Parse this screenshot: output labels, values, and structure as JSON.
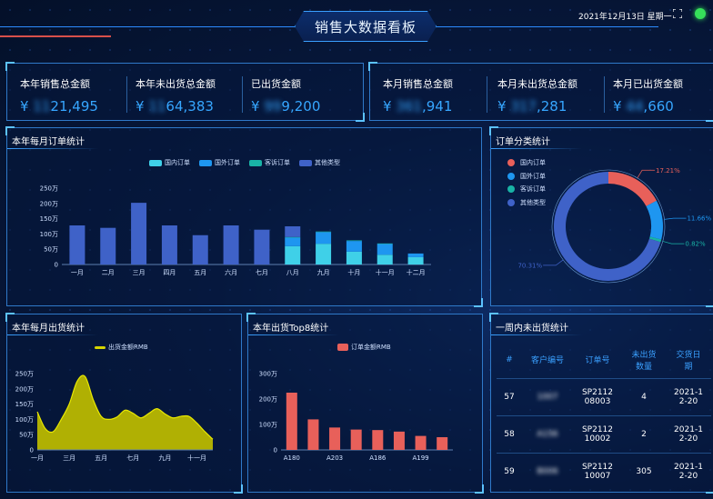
{
  "header": {
    "title": "销售大数据看板",
    "datetime": "2021年12月13日 星期一"
  },
  "stats_left": [
    {
      "label": "本年销售总金额",
      "prefix": "¥",
      "hidden": "11",
      "value": "21,495"
    },
    {
      "label": "本年未出货总金额",
      "prefix": "¥",
      "hidden": "11",
      "value": "64,383"
    },
    {
      "label": "已出货金额",
      "prefix": "¥",
      "hidden": "99",
      "value": "9,200"
    }
  ],
  "stats_right": [
    {
      "label": "本月销售总金额",
      "prefix": "¥",
      "hidden": "361",
      "value": ",941"
    },
    {
      "label": "本月未出货总金额",
      "prefix": "¥",
      "hidden": "317",
      "value": ",281"
    },
    {
      "label": "本月已出货金额",
      "prefix": "¥",
      "hidden": "44",
      "value": ",660"
    }
  ],
  "panels": {
    "monthly_orders": "本年每月订单统计",
    "order_category": "订单分类统计",
    "monthly_shipments": "本年每月出货统计",
    "top8": "本年出货Top8统计",
    "week_unshipped": "一周内未出货统计"
  },
  "chart_data": [
    {
      "type": "bar",
      "title": "本年每月订单统计",
      "categories": [
        "一月",
        "二月",
        "三月",
        "四月",
        "五月",
        "六月",
        "七月",
        "八月",
        "九月",
        "十月",
        "十一月",
        "十二月"
      ],
      "yticks": [
        "0",
        "50万",
        "100万",
        "150万",
        "200万",
        "250万"
      ],
      "ylim": [
        0,
        250
      ],
      "legend": "top",
      "series": [
        {
          "name": "国内订单",
          "color": "#3fd0e8",
          "values": [
            0,
            0,
            0,
            0,
            0,
            0,
            0,
            60,
            68,
            42,
            32,
            24
          ]
        },
        {
          "name": "国外订单",
          "color": "#1e96f0",
          "values": [
            0,
            0,
            0,
            0,
            0,
            0,
            0,
            28,
            38,
            35,
            35,
            12
          ]
        },
        {
          "name": "客诉订单",
          "color": "#19b3a6",
          "values": [
            0,
            0,
            0,
            0,
            0,
            0,
            0,
            2,
            2,
            2,
            2,
            0
          ]
        },
        {
          "name": "其他类型",
          "color": "#3f62c8",
          "values": [
            128,
            120,
            202,
            128,
            96,
            128,
            114,
            35,
            0,
            0,
            0,
            0
          ]
        }
      ]
    },
    {
      "type": "pie",
      "title": "订单分类统计",
      "legend": "top-left",
      "slices": [
        {
          "name": "国内订单",
          "value": 17.21,
          "label": "17.21%",
          "color": "#e8605a"
        },
        {
          "name": "国外订单",
          "value": 11.66,
          "label": "11.66%",
          "color": "#1e96f0"
        },
        {
          "name": "客诉订单",
          "value": 0.82,
          "label": "0.82%",
          "color": "#19b3a6"
        },
        {
          "name": "其他类型",
          "value": 70.31,
          "label": "70.31%",
          "color": "#3f62c8"
        }
      ]
    },
    {
      "type": "area",
      "title": "本年每月出货统计",
      "legend": "top",
      "series": [
        {
          "name": "出货金额RMB",
          "color": "#d6d600"
        }
      ],
      "xticks": [
        "一月",
        "三月",
        "五月",
        "七月",
        "九月",
        "十一月"
      ],
      "yticks": [
        "0",
        "50万",
        "100万",
        "150万",
        "200万",
        "250万"
      ],
      "ylim": [
        0,
        250
      ],
      "x": [
        1,
        1.5,
        2,
        2.5,
        3,
        3.5,
        4,
        4.5,
        5,
        5.5,
        6,
        6.5,
        7,
        7.5,
        8,
        8.5,
        9,
        9.5,
        10,
        10.5,
        11,
        11.5,
        12
      ],
      "values": [
        125,
        70,
        60,
        100,
        150,
        225,
        240,
        165,
        110,
        100,
        108,
        130,
        120,
        105,
        120,
        135,
        118,
        105,
        110,
        110,
        88,
        60,
        35
      ]
    },
    {
      "type": "bar",
      "title": "本年出货Top8统计",
      "legend": "top",
      "series": [
        {
          "name": "订单金额RMB",
          "color": "#e8605a"
        }
      ],
      "categories": [
        "A180",
        "",
        "A203",
        "",
        "A186",
        "",
        "A199",
        ""
      ],
      "xticks": [
        "A180",
        "A203",
        "A186",
        "A199"
      ],
      "yticks": [
        "0",
        "100万",
        "200万",
        "300万"
      ],
      "ylim": [
        0,
        300
      ],
      "values": [
        225,
        120,
        88,
        80,
        78,
        72,
        55,
        50
      ]
    }
  ],
  "week_table": {
    "headers": [
      "#",
      "客户编号",
      "订单号",
      "未出货\n数量",
      "交货日\n期"
    ],
    "rows": [
      {
        "idx": "57",
        "customer": "1007",
        "order": "SP2112\n08003",
        "qty": "4",
        "date": "2021-1\n2-20"
      },
      {
        "idx": "58",
        "customer": "A156",
        "order": "SP2112\n10002",
        "qty": "2",
        "date": "2021-1\n2-20"
      },
      {
        "idx": "59",
        "customer": "B006",
        "order": "SP2112\n10007",
        "qty": "305",
        "date": "2021-1\n2-20"
      }
    ]
  },
  "colors": {
    "accent": "#3aa0ff",
    "panel_border": "#2f79c9",
    "value": "#36a6ff"
  },
  "icons": {
    "fullscreen": "fullscreen-icon",
    "status": "status-dot"
  }
}
